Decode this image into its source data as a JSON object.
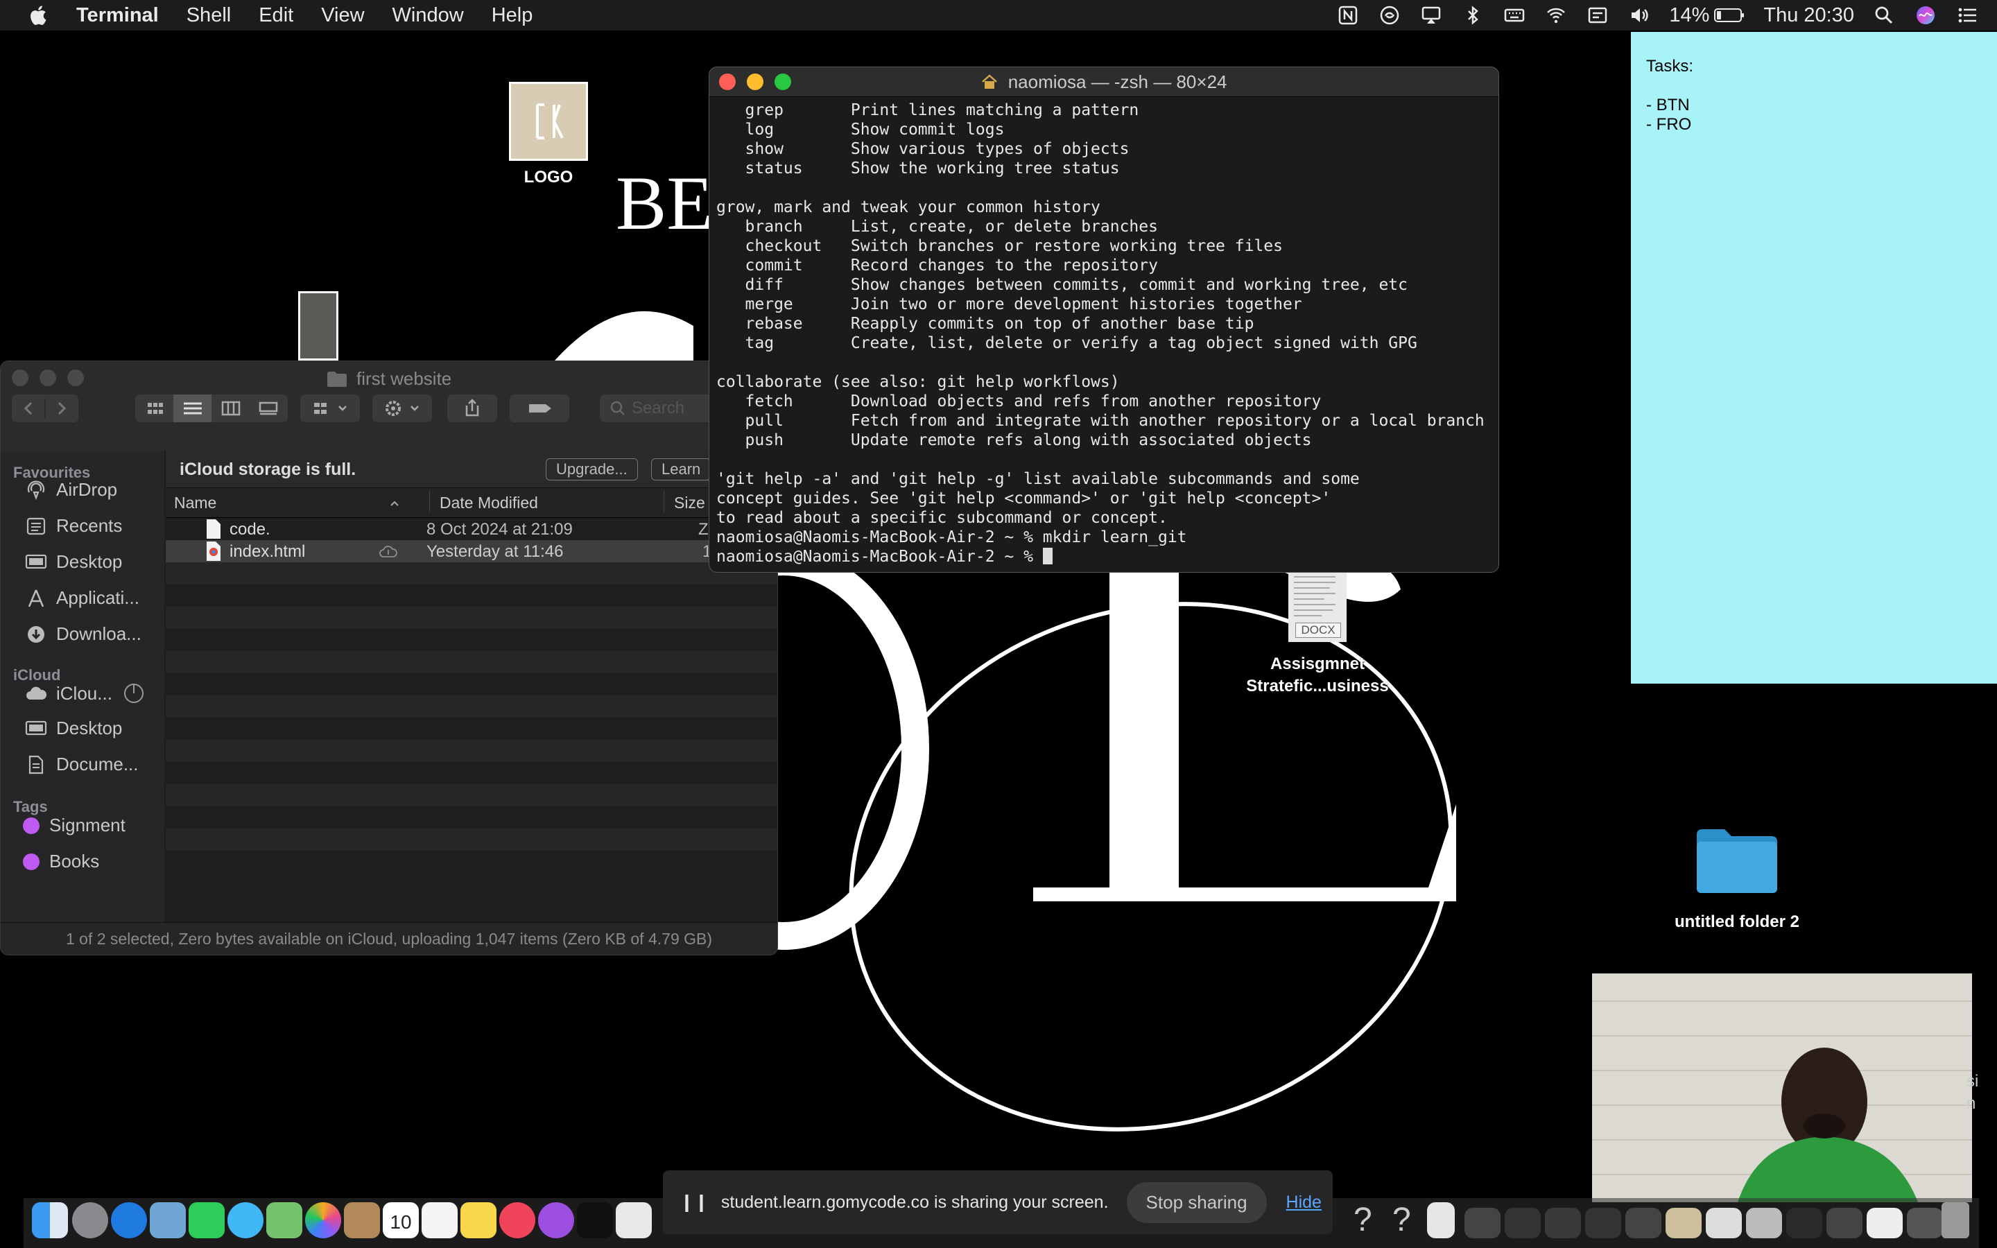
{
  "menubar": {
    "app_name": "Terminal",
    "menus": [
      "Shell",
      "Edit",
      "View",
      "Window",
      "Help"
    ],
    "battery": "14%",
    "clock": "Thu 20:30"
  },
  "wallpaper": {
    "partial_text": "BE"
  },
  "desktop": {
    "logo_label": "LOGO",
    "docx_badge": "DOCX",
    "docx_label_line1": "Assisgmnet",
    "docx_label_line2": "Stratefic...usiness",
    "folder_label": "untitled folder 2"
  },
  "finder": {
    "title": "first website",
    "search_placeholder": "Search",
    "sidebar": {
      "favourites_header": "Favourites",
      "favourites": [
        "AirDrop",
        "Recents",
        "Desktop",
        "Applicati...",
        "Downloa..."
      ],
      "icloud_header": "iCloud",
      "icloud": [
        "iClou...",
        "Desktop",
        "Docume..."
      ],
      "tags_header": "Tags",
      "tags": [
        "Signment",
        "Books"
      ]
    },
    "banner": {
      "message": "iCloud storage is full.",
      "upgrade": "Upgrade...",
      "learn": "Learn"
    },
    "columns": {
      "name": "Name",
      "date": "Date Modified",
      "size": "Size"
    },
    "files": [
      {
        "name": "code.",
        "date": "8 Oct 2024 at 21:09",
        "size": "Z"
      },
      {
        "name": "index.html",
        "date": "Yesterday at 11:46",
        "size": "1"
      }
    ],
    "status": "1 of 2 selected, Zero bytes available on iCloud, uploading 1,047 items (Zero KB of 4.79 GB)"
  },
  "terminal": {
    "title": "naomiosa — -zsh — 80×24",
    "lines": [
      "   grep       Print lines matching a pattern",
      "   log        Show commit logs",
      "   show       Show various types of objects",
      "   status     Show the working tree status",
      "",
      "grow, mark and tweak your common history",
      "   branch     List, create, or delete branches",
      "   checkout   Switch branches or restore working tree files",
      "   commit     Record changes to the repository",
      "   diff       Show changes between commits, commit and working tree, etc",
      "   merge      Join two or more development histories together",
      "   rebase     Reapply commits on top of another base tip",
      "   tag        Create, list, delete or verify a tag object signed with GPG",
      "",
      "collaborate (see also: git help workflows)",
      "   fetch      Download objects and refs from another repository",
      "   pull       Fetch from and integrate with another repository or a local branch",
      "   push       Update remote refs along with associated objects",
      "",
      "'git help -a' and 'git help -g' list available subcommands and some",
      "concept guides. See 'git help <command>' or 'git help <concept>'",
      "to read about a specific subcommand or concept.",
      "naomiosa@Naomis-MacBook-Air-2 ~ % mkdir learn_git"
    ],
    "prompt": "naomiosa@Naomis-MacBook-Air-2 ~ % "
  },
  "sticky": {
    "heading": "Tasks:",
    "items": [
      "- BTN",
      "- FRO"
    ]
  },
  "webcam": {
    "side_text_1": "si",
    "side_text_2": "n"
  },
  "sharebar": {
    "message": "student.learn.gomycode.co is sharing your screen.",
    "stop": "Stop sharing",
    "hide": "Hide"
  },
  "dock": {
    "calendar_date": "10"
  }
}
